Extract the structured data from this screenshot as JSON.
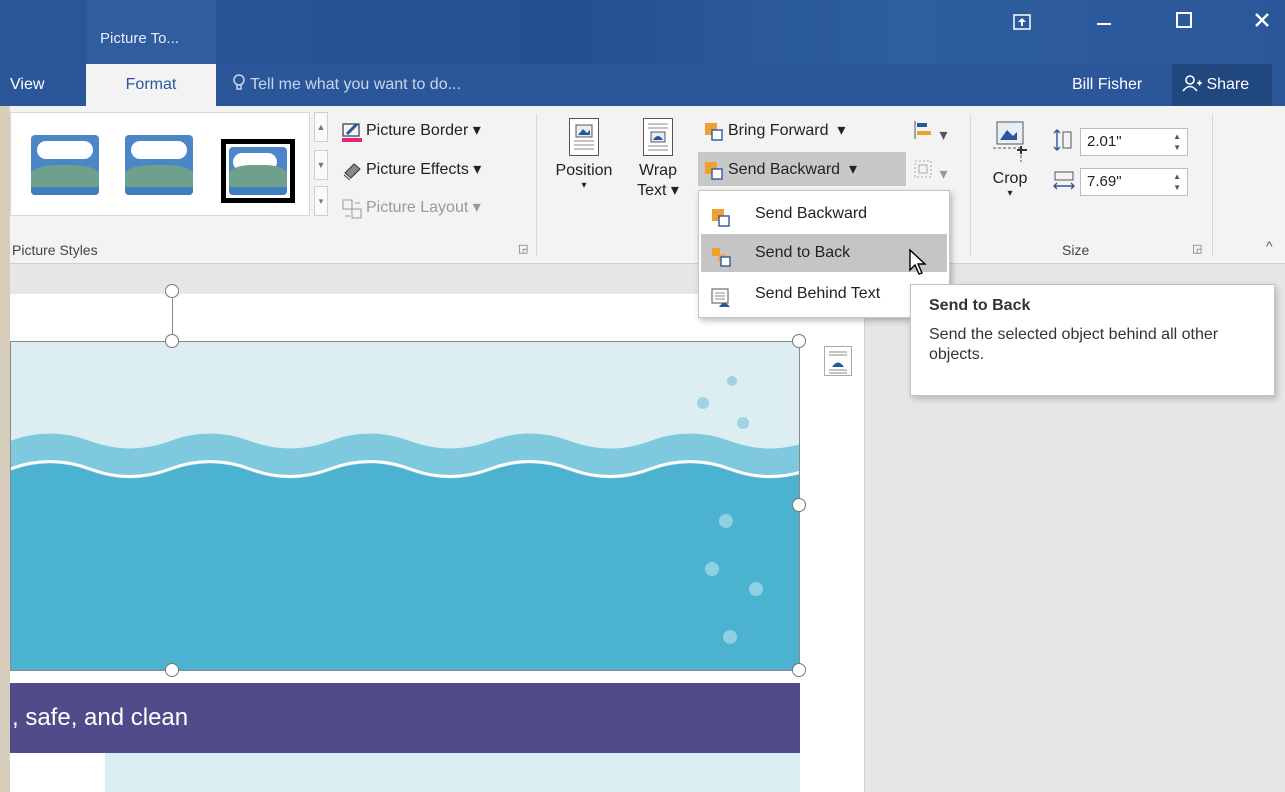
{
  "titlebar": {
    "context_group": "Picture To...",
    "controls": [
      "ribbon-display-options",
      "minimize",
      "maximize",
      "close"
    ]
  },
  "tabs": {
    "view": "View",
    "format": "Format",
    "tell_me": "Tell me what you want to do...",
    "user": "Bill Fisher",
    "share": "Share"
  },
  "ribbon": {
    "picture_styles": {
      "label": "Picture Styles",
      "picture_border": "Picture Border",
      "picture_effects": "Picture Effects",
      "picture_layout": "Picture Layout"
    },
    "arrange": {
      "position": "Position",
      "wrap_line1": "Wrap",
      "wrap_line2": "Text",
      "bring_forward": "Bring Forward",
      "send_backward": "Send Backward"
    },
    "size": {
      "label": "Size",
      "crop": "Crop",
      "height": "2.01\"",
      "width": "7.69\""
    }
  },
  "dropdown": {
    "items": [
      {
        "label": "Send Backward",
        "icon": "send-backward-icon"
      },
      {
        "label": "Send to Back",
        "icon": "send-to-back-icon"
      },
      {
        "label": "Send Behind Text",
        "icon": "send-behind-text-icon"
      }
    ]
  },
  "tooltip": {
    "title": "Send to Back",
    "body": "Send the selected object behind all other objects."
  },
  "document": {
    "banner_text": ", safe, and clean"
  },
  "colors": {
    "title_bar": "#2b579a",
    "banner": "#514b8a",
    "water_dark": "#4bb3cf",
    "water_light": "#7fc9de"
  }
}
